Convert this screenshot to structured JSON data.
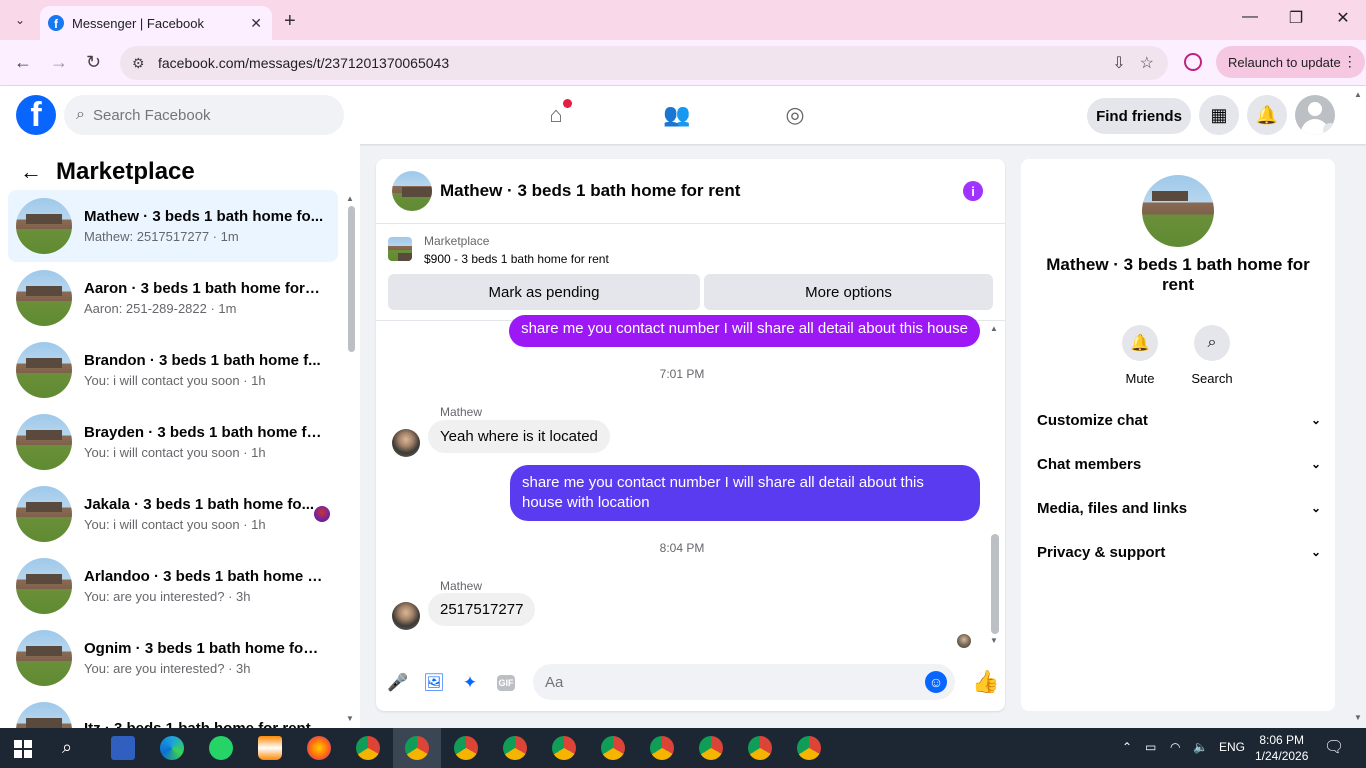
{
  "browser": {
    "tab_title": "Messenger | Facebook",
    "url": "facebook.com/messages/t/2371201370065043",
    "relaunch_label": "Relaunch to update"
  },
  "fb": {
    "search_placeholder": "Search Facebook",
    "find_friends": "Find friends"
  },
  "sidebar": {
    "title": "Marketplace",
    "conversations": [
      {
        "name": "Mathew · 3 beds 1 bath home fo...",
        "sub": "Mathew: 2517517277 · 1m"
      },
      {
        "name": "Aaron · 3 beds 1 bath home for r...",
        "sub": "Aaron: 251-289-2822 · 1m"
      },
      {
        "name": "Brandon · 3 beds 1 bath home f...",
        "sub": "You: i will contact you soon · 1h"
      },
      {
        "name": "Brayden · 3 beds 1 bath home fo...",
        "sub": "You: i will contact you soon · 1h"
      },
      {
        "name": "Jakala · 3 beds 1 bath home fo...",
        "sub": "You: i will contact you soon · 1h"
      },
      {
        "name": "Arlandoo · 3 beds 1 bath home f...",
        "sub": "You: are you interested? · 3h"
      },
      {
        "name": "Ognim · 3 beds 1 bath home for ...",
        "sub": "You: are you interested? · 3h"
      },
      {
        "name": "Itz · 3 beds 1 bath home for rent",
        "sub": ""
      }
    ]
  },
  "chat": {
    "title": "Mathew · 3 beds 1 bath home for rent",
    "listing_label": "Marketplace",
    "listing_price": "$900 - 3 beds 1 bath home for rent",
    "mark_pending": "Mark as pending",
    "more_options": "More options",
    "messages": {
      "out1": "share me you contact number I will share all detail about this house",
      "ts1": "7:01 PM",
      "sender1": "Mathew",
      "in1": "Yeah where is it located",
      "out2": "share me you contact number I will share all detail about this house with location",
      "ts2": "8:04 PM",
      "sender2": "Mathew",
      "in2": "2517517277"
    },
    "composer_placeholder": "Aa"
  },
  "details": {
    "title": "Mathew · 3 beds 1 bath home for rent",
    "mute": "Mute",
    "search": "Search",
    "sections": [
      "Customize chat",
      "Chat members",
      "Media, files and links",
      "Privacy & support"
    ]
  },
  "taskbar": {
    "lang": "ENG",
    "time": "8:06 PM",
    "date": "1/24/2026"
  },
  "colors": {
    "fb_blue": "#0866ff",
    "out_bubble_violet": "#9c19f6",
    "out_bubble_indigo": "#5b3bf0",
    "notification_red": "#e41e3f"
  }
}
